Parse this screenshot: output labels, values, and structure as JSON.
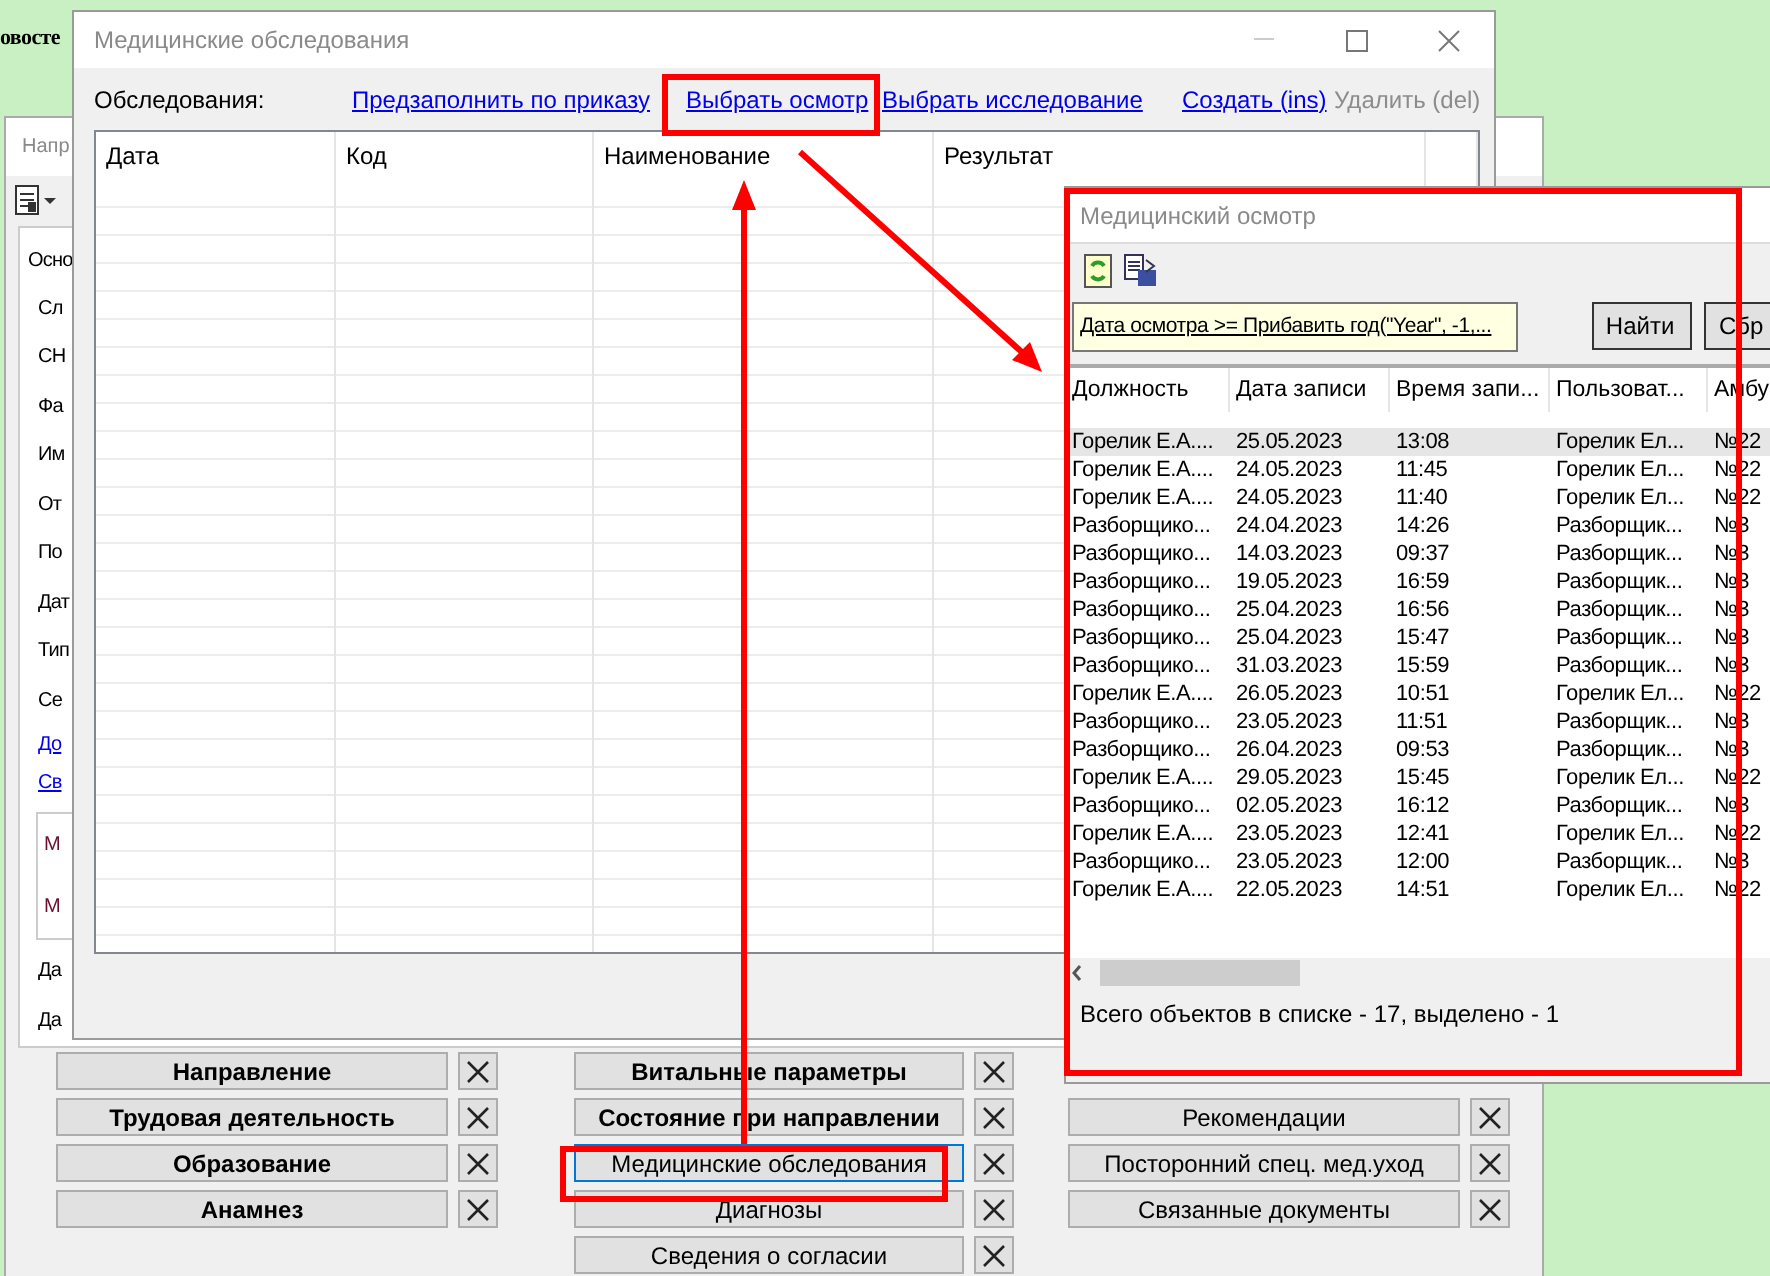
{
  "background_heading": "овосте",
  "back_window": {
    "title": "Напр",
    "form_rows": [
      {
        "kind": "tab",
        "text": "Осно"
      },
      {
        "kind": "label",
        "text": "Сл"
      },
      {
        "kind": "label",
        "text": "СН"
      },
      {
        "kind": "label",
        "text": "Фа"
      },
      {
        "kind": "label",
        "text": "Им"
      },
      {
        "kind": "label",
        "text": "От"
      },
      {
        "kind": "label",
        "text": "По"
      },
      {
        "kind": "label",
        "text": "Дат"
      },
      {
        "kind": "label",
        "text": "Тип"
      },
      {
        "kind": "label",
        "text": "Се"
      },
      {
        "kind": "link",
        "text": "До"
      },
      {
        "kind": "link",
        "text": "Св"
      },
      {
        "kind": "group",
        "items": [
          "М",
          "М"
        ]
      },
      {
        "kind": "label",
        "text": "Да"
      },
      {
        "kind": "label",
        "text": "Да"
      }
    ],
    "section_columns": [
      [
        {
          "label": "Направление",
          "bold": true,
          "selected": false
        },
        {
          "label": "Трудовая деятельность",
          "bold": true,
          "selected": false
        },
        {
          "label": "Образование",
          "bold": true,
          "selected": false
        },
        {
          "label": "Анамнез",
          "bold": true,
          "selected": false
        }
      ],
      [
        {
          "label": "Витальные параметры",
          "bold": true,
          "selected": false
        },
        {
          "label": "Состояние при направлении",
          "bold": true,
          "selected": false
        },
        {
          "label": "Медицинские обследования",
          "bold": false,
          "selected": true
        },
        {
          "label": "Диагнозы",
          "bold": false,
          "selected": false
        },
        {
          "label": "Сведения о согласии",
          "bold": false,
          "selected": false
        }
      ],
      [
        {
          "label": "Рекомендации",
          "bold": false,
          "selected": false
        },
        {
          "label": "Посторонний спец. мед.уход",
          "bold": false,
          "selected": false
        },
        {
          "label": "Связанные документы",
          "bold": false,
          "selected": false
        }
      ]
    ]
  },
  "exams_window": {
    "title": "Медицинские обследования",
    "toolbar_label": "Обследования:",
    "actions": [
      {
        "label": "Предзаполнить по приказу",
        "disabled": false
      },
      {
        "label": "Выбрать осмотр",
        "disabled": false
      },
      {
        "label": "Выбрать исследование",
        "disabled": false
      },
      {
        "label": "Создать (ins)",
        "disabled": false
      },
      {
        "label": "Удалить (del)",
        "disabled": true
      }
    ],
    "table": {
      "columns": [
        "Дата",
        "Код",
        "Наименование",
        "Результат"
      ]
    }
  },
  "checkup_window": {
    "title": "Медицинский осмотр",
    "filter": "Дата осмотра >= Прибавить год(\"Year\", -1,...",
    "buttons": [
      "Найти",
      "Сбр"
    ],
    "table": {
      "columns": [
        "Должность",
        "Дата записи",
        "Время запи...",
        "Пользоват...",
        "Амбу"
      ],
      "rows": [
        {
          "cells": [
            "Горелик Е.А....",
            "25.05.2023",
            "13:08",
            "Горелик Ел...",
            "№22"
          ],
          "selected": true
        },
        {
          "cells": [
            "Горелик Е.А....",
            "24.05.2023",
            "11:45",
            "Горелик Ел...",
            "№22"
          ],
          "selected": false
        },
        {
          "cells": [
            "Горелик Е.А....",
            "24.05.2023",
            "11:40",
            "Горелик Ел...",
            "№22"
          ],
          "selected": false
        },
        {
          "cells": [
            "Разборщико...",
            "24.04.2023",
            "14:26",
            "Разборщик...",
            "№3"
          ],
          "selected": false
        },
        {
          "cells": [
            "Разборщико...",
            "14.03.2023",
            "09:37",
            "Разборщик...",
            "№3"
          ],
          "selected": false
        },
        {
          "cells": [
            "Разборщико...",
            "19.05.2023",
            "16:59",
            "Разборщик...",
            "№3"
          ],
          "selected": false
        },
        {
          "cells": [
            "Разборщико...",
            "25.04.2023",
            "16:56",
            "Разборщик...",
            "№3"
          ],
          "selected": false
        },
        {
          "cells": [
            "Разборщико...",
            "25.04.2023",
            "15:47",
            "Разборщик...",
            "№3"
          ],
          "selected": false
        },
        {
          "cells": [
            "Разборщико...",
            "31.03.2023",
            "15:59",
            "Разборщик...",
            "№3"
          ],
          "selected": false
        },
        {
          "cells": [
            "Горелик Е.А....",
            "26.05.2023",
            "10:51",
            "Горелик Ел...",
            "№22"
          ],
          "selected": false
        },
        {
          "cells": [
            "Разборщико...",
            "23.05.2023",
            "11:51",
            "Разборщик...",
            "№3"
          ],
          "selected": false
        },
        {
          "cells": [
            "Разборщико...",
            "26.04.2023",
            "09:53",
            "Разборщик...",
            "№3"
          ],
          "selected": false
        },
        {
          "cells": [
            "Горелик Е.А....",
            "29.05.2023",
            "15:45",
            "Горелик Ел...",
            "№22"
          ],
          "selected": false
        },
        {
          "cells": [
            "Разборщико...",
            "02.05.2023",
            "16:12",
            "Разборщик...",
            "№3"
          ],
          "selected": false
        },
        {
          "cells": [
            "Горелик Е.А....",
            "23.05.2023",
            "12:41",
            "Горелик Ел...",
            "№22"
          ],
          "selected": false
        },
        {
          "cells": [
            "Разборщико...",
            "23.05.2023",
            "12:00",
            "Разборщик...",
            "№3"
          ],
          "selected": false
        },
        {
          "cells": [
            "Горелик Е.А....",
            "22.05.2023",
            "14:51",
            "Горелик Ел...",
            "№22"
          ],
          "selected": false
        }
      ]
    },
    "status": "Всего объектов в списке - 17, выделено - 1"
  }
}
